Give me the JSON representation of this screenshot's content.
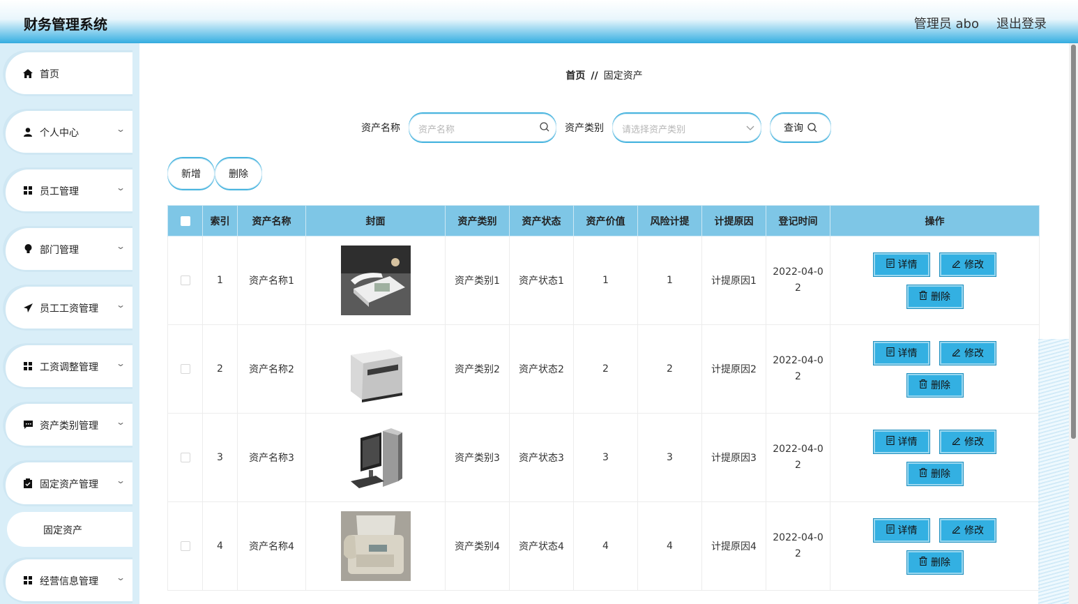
{
  "header": {
    "title": "财务管理系统",
    "admin": "管理员 abo",
    "logout": "退出登录"
  },
  "sidebar": {
    "items": [
      {
        "label": "首页",
        "icon": "home-icon"
      },
      {
        "label": "个人中心",
        "icon": "user-icon"
      },
      {
        "label": "员工管理",
        "icon": "grid-icon"
      },
      {
        "label": "部门管理",
        "icon": "bulb-icon"
      },
      {
        "label": "员工工资管理",
        "icon": "send-icon"
      },
      {
        "label": "工资调整管理",
        "icon": "grid-icon"
      },
      {
        "label": "资产类别管理",
        "icon": "chat-icon"
      },
      {
        "label": "固定资产管理",
        "icon": "clipboard-icon"
      },
      {
        "label": "经营信息管理",
        "icon": "grid-icon"
      }
    ],
    "submenu": {
      "label": "固定资产"
    }
  },
  "breadcrumb": {
    "home": "首页",
    "separator": "//",
    "current": "固定资产"
  },
  "search": {
    "name_label": "资产名称",
    "name_placeholder": "资产名称",
    "type_label": "资产类别",
    "type_placeholder": "请选择资产类别",
    "query_label": "查询"
  },
  "actions": {
    "add": "新增",
    "delete": "删除"
  },
  "table": {
    "headers": [
      "索引",
      "资产名称",
      "封面",
      "资产类别",
      "资产状态",
      "资产价值",
      "风险计提",
      "计提原因",
      "登记时间",
      "操作"
    ],
    "rows": [
      {
        "index": "1",
        "name": "资产名称1",
        "category": "资产类别1",
        "status": "资产状态1",
        "value": "1",
        "risk": "1",
        "reason": "计提原因1",
        "date_a": "2022-04-0",
        "date_b": "2",
        "cover": "telephone"
      },
      {
        "index": "2",
        "name": "资产名称2",
        "category": "资产类别2",
        "status": "资产状态2",
        "value": "2",
        "risk": "2",
        "reason": "计提原因2",
        "date_a": "2022-04-0",
        "date_b": "2",
        "cover": "printer"
      },
      {
        "index": "3",
        "name": "资产名称3",
        "category": "资产类别3",
        "status": "资产状态3",
        "value": "3",
        "risk": "3",
        "reason": "计提原因3",
        "date_a": "2022-04-0",
        "date_b": "2",
        "cover": "computer"
      },
      {
        "index": "4",
        "name": "资产名称4",
        "category": "资产类别4",
        "status": "资产状态4",
        "value": "4",
        "risk": "4",
        "reason": "计提原因4",
        "date_a": "2022-04-0",
        "date_b": "2",
        "cover": "fax-machine"
      }
    ],
    "op_labels": {
      "detail": "详情",
      "edit": "修改",
      "delete": "删除"
    }
  },
  "colors": {
    "accent": "#33b0e2",
    "header_bottom": "#3ab0e2",
    "table_header": "#7ec6e6",
    "sidebar_bg": "#d9eef8"
  }
}
